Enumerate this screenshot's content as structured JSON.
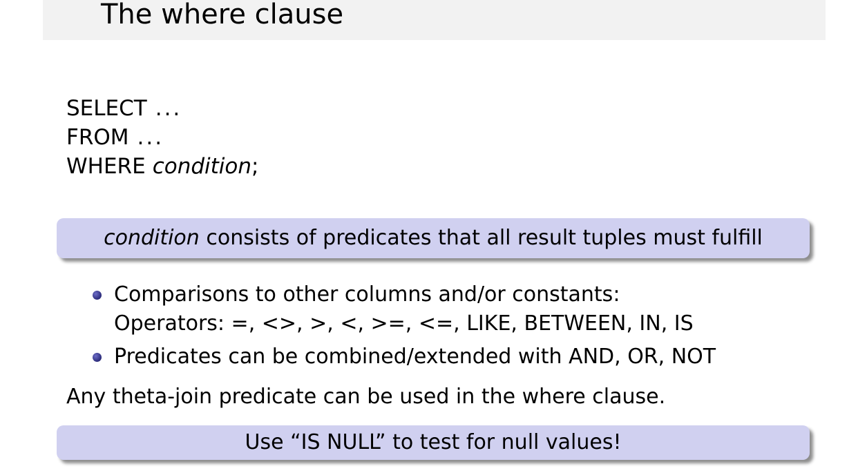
{
  "slide": {
    "title": "The where clause",
    "sql": {
      "select_keyword": "SELECT",
      "select_rest": "...",
      "from_keyword": "FROM",
      "from_rest": "...",
      "where_keyword": "WHERE",
      "where_condition": "condition",
      "where_end": ";"
    },
    "block1": {
      "italic": "condition",
      "text": " consists of predicates that all result tuples must fulfill"
    },
    "bullets": [
      {
        "line1": "Comparisons to other columns and/or constants:",
        "line2": "Operators: =, <>, >, <, >=, <=, LIKE, BETWEEN, IN, IS"
      },
      {
        "line1": "Predicates can be combined/extended with AND, OR, NOT"
      }
    ],
    "note": "Any theta-join predicate can be used in the where clause.",
    "block2": {
      "text": "Use “IS NULL” to test for null values!"
    }
  },
  "colors": {
    "title_bar": "#f2f2f2",
    "block_fill": "#d0d0f0",
    "bullet": "#2b2b7a"
  }
}
